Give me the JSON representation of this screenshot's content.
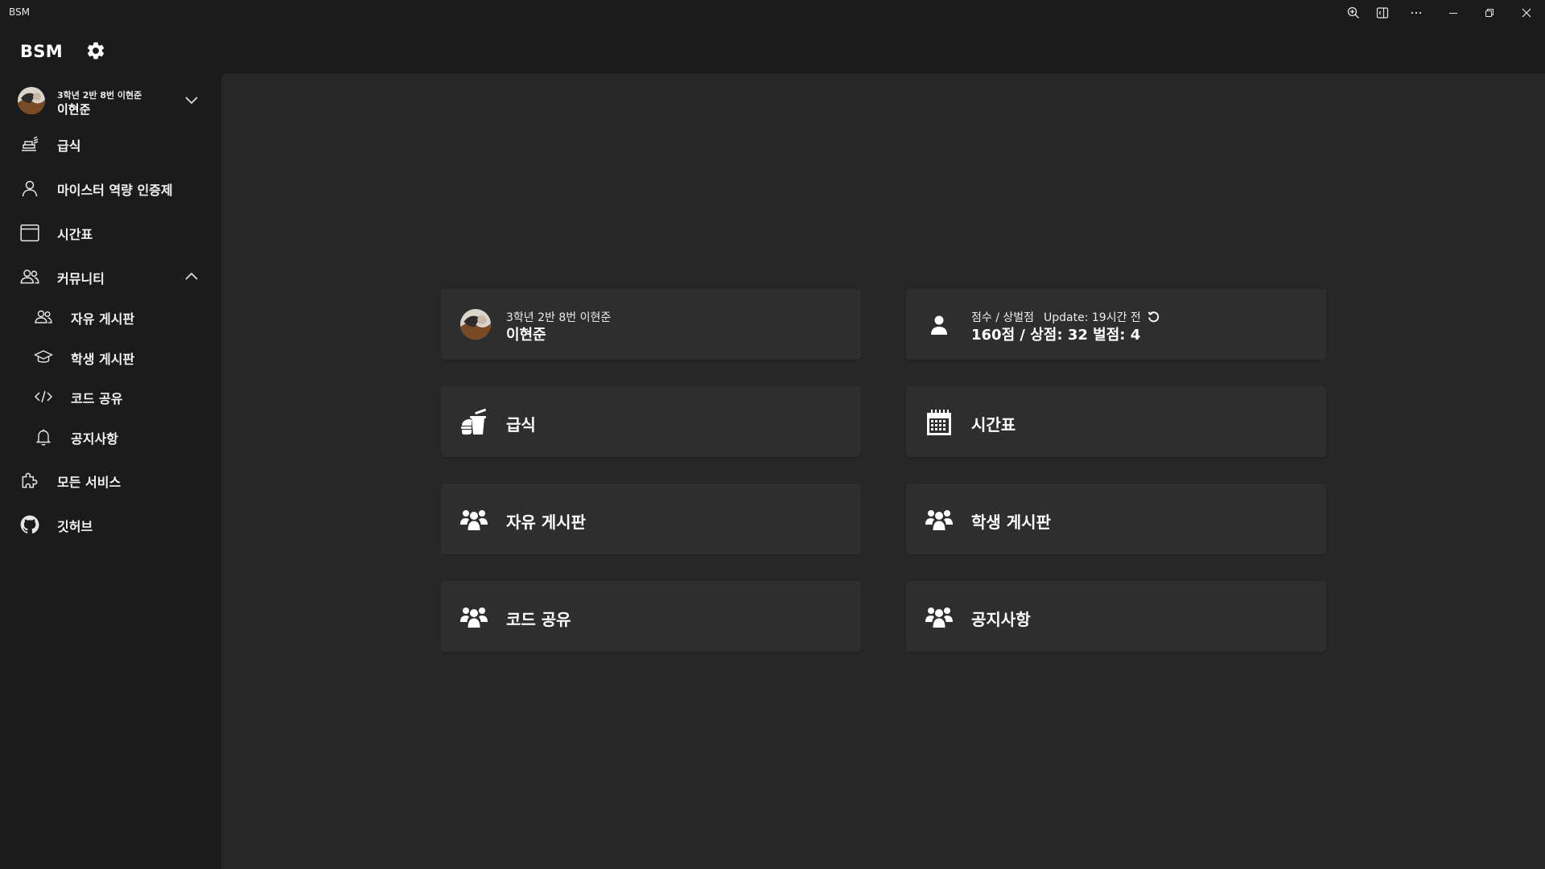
{
  "window": {
    "title": "BSM",
    "controls": [
      "zoom-in-icon",
      "app-mode-icon",
      "more-icon",
      "minimize-icon",
      "restore-icon",
      "close-icon"
    ]
  },
  "sidebar": {
    "brand": "BSM",
    "profile": {
      "info": "3학년 2반 8번 이현준",
      "name": "이현준"
    },
    "items": [
      {
        "label": "급식",
        "icon": "meal-tray-icon"
      },
      {
        "label": "마이스터 역량 인증제",
        "icon": "person-icon"
      },
      {
        "label": "시간표",
        "icon": "calendar-icon"
      },
      {
        "label": "커뮤니티",
        "icon": "people-icon",
        "expanded": true
      },
      {
        "label": "모든 서비스",
        "icon": "puzzle-icon"
      },
      {
        "label": "깃허브",
        "icon": "github-icon"
      }
    ],
    "community_items": [
      {
        "label": "자유 게시판",
        "icon": "people-icon"
      },
      {
        "label": "학생 게시판",
        "icon": "graduation-cap-icon"
      },
      {
        "label": "코드 공유",
        "icon": "code-icon"
      },
      {
        "label": "공지사항",
        "icon": "bell-icon"
      }
    ]
  },
  "main": {
    "profile_card": {
      "info": "3학년 2반 8번 이현준",
      "name": "이현준"
    },
    "score_card": {
      "label": "점수 / 상벌점",
      "update": "Update: 19시간 전",
      "summary": "160점 / 상점: 32 벌점: 4"
    },
    "cards": [
      {
        "label": "급식",
        "icon": "meal-icon"
      },
      {
        "label": "시간표",
        "icon": "calendar-icon"
      },
      {
        "label": "자유 게시판",
        "icon": "users-icon"
      },
      {
        "label": "학생 게시판",
        "icon": "users-icon"
      },
      {
        "label": "코드 공유",
        "icon": "users-icon"
      },
      {
        "label": "공지사항",
        "icon": "users-icon"
      }
    ]
  }
}
